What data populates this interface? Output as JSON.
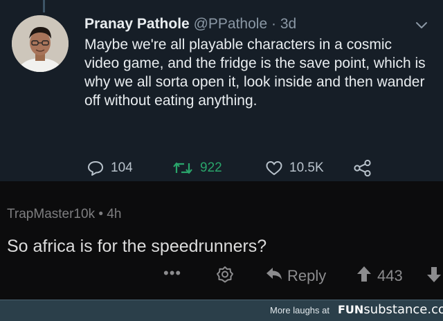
{
  "tweet": {
    "author_name": "Pranay Pathole",
    "handle": "@PPathole",
    "separator": "·",
    "time": "3d",
    "text": "Maybe we're all playable characters in a cosmic video game, and the fridge is the save point, which is why we all sorta open it, look inside and then wander off without eating anything.",
    "reply_count": "104",
    "retweet_count": "922",
    "like_count": "10.5K",
    "icons": {
      "reply": "speech-bubble-icon",
      "retweet": "retweet-icon",
      "like": "heart-icon",
      "share": "share-icon",
      "menu": "chevron-down-icon"
    },
    "colors": {
      "background": "#161e27",
      "retweet_green": "#2aa56b"
    }
  },
  "comment": {
    "username": "TrapMaster10k",
    "separator": "•",
    "time": "4h",
    "text": "So africa is for the speedrunners?",
    "more": "•••",
    "reply_label": "Reply",
    "score": "443",
    "icons": {
      "award": "award-icon",
      "reply": "reply-arrow-icon",
      "upvote": "upvote-arrow-icon",
      "downvote": "downvote-arrow-icon"
    }
  },
  "footer": {
    "more_text": "More laughs at",
    "brand_part1": "FUN",
    "brand_part2": "substance",
    "brand_tld": ".com",
    "colors": {
      "background": "#2b3f4a"
    }
  }
}
